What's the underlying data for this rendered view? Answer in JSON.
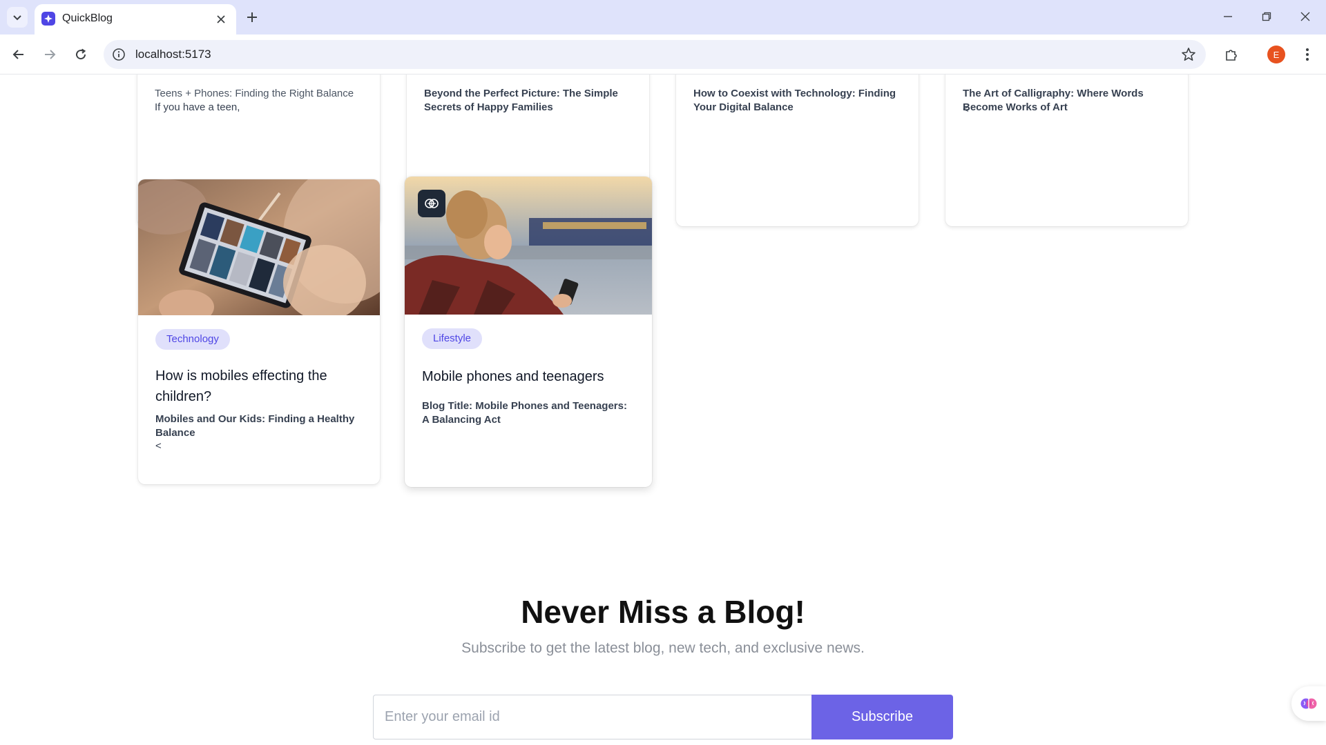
{
  "browser": {
    "tab_title": "QuickBlog",
    "url": "localhost:5173",
    "profile_initial": "E"
  },
  "top_cards": [
    {
      "title": "Teens + Phones: Finding the Right Balance",
      "text": "If you have a teen,"
    },
    {
      "title": "Beyond the Perfect Picture: The Simple Secrets of Happy Families"
    },
    {
      "title": "How to Coexist with Technology: Finding Your Digital Balance"
    },
    {
      "title": "The Art of Calligraphy: Where Words Become Works of Art",
      "extra": "<"
    }
  ],
  "cards": [
    {
      "tag": "Technology",
      "title": "How is mobiles effecting the children?",
      "subtitle": "Mobiles and Our Kids: Finding a Healthy Balance",
      "extra": "<"
    },
    {
      "tag": "Lifestyle",
      "title": "Mobile phones and teenagers",
      "subtitle": "Blog Title: Mobile Phones and Teenagers: A Balancing Act"
    }
  ],
  "newsletter": {
    "heading": "Never Miss a Blog!",
    "subheading": "Subscribe to get the latest blog, new tech, and exclusive news.",
    "email_placeholder": "Enter your email id",
    "button_label": "Subscribe"
  },
  "colors": {
    "accent": "#6c63e6",
    "tag_bg": "#e0e0fb",
    "tag_text": "#4f46e5",
    "tabbar_bg": "#dfe3fb"
  }
}
